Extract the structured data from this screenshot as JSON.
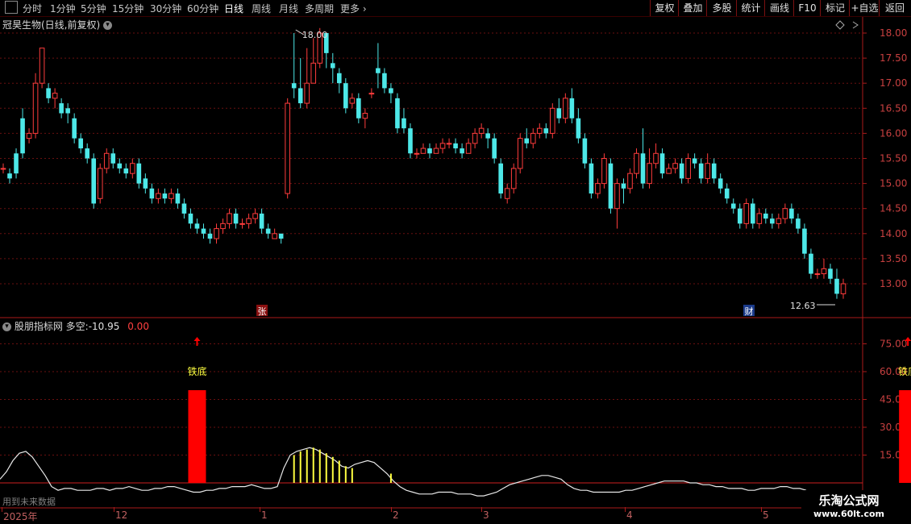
{
  "toolbar": {
    "periods": [
      "分时",
      "1分钟",
      "5分钟",
      "15分钟",
      "30分钟",
      "60分钟",
      "日线",
      "周线",
      "月线",
      "多周期",
      "更多"
    ],
    "active_period": "日线",
    "right_buttons": [
      "复权",
      "叠加",
      "多股",
      "统计",
      "画线",
      "F10",
      "标记",
      "+自选",
      "返回"
    ]
  },
  "stock": {
    "title": "冠昊生物(日线,前复权)",
    "high_label": "18.00",
    "low_label": "12.63",
    "badge_zhang": "张",
    "badge_cai": "财"
  },
  "indicator": {
    "name": "股朋指标网",
    "label": "多空:",
    "value": "-10.95",
    "value2": "0.00",
    "signal_text": "铁底",
    "future_note": "用到未来数据"
  },
  "price_axis": [
    "18.00",
    "17.50",
    "17.00",
    "16.50",
    "16.00",
    "15.50",
    "15.00",
    "14.50",
    "14.00",
    "13.50",
    "13.00"
  ],
  "indicator_axis": [
    "75.00",
    "60.00",
    "45.00",
    "30.00",
    "15.00"
  ],
  "date_axis": [
    "2025年",
    "12",
    "1",
    "2",
    "3",
    "4",
    "5"
  ],
  "watermark": {
    "line1": "乐淘公式网",
    "line2": "www.60lt.com"
  },
  "colors": {
    "up": "#ff3c3c",
    "down": "#4de8e8",
    "grid": "#6a1010",
    "signal": "#ff0000",
    "text_yellow": "#ffff40"
  },
  "candles": [
    [
      15.3,
      15.3,
      15.4,
      15.2
    ],
    [
      15.2,
      15.1,
      15.3,
      15.0
    ],
    [
      15.6,
      15.2,
      15.7,
      15.1
    ],
    [
      16.3,
      15.6,
      16.5,
      15.5
    ],
    [
      15.9,
      16.0,
      16.1,
      15.8
    ],
    [
      16.0,
      17.0,
      17.2,
      15.9
    ],
    [
      17.0,
      17.7,
      17.7,
      16.9
    ],
    [
      16.9,
      16.7,
      17.0,
      16.6
    ],
    [
      16.7,
      16.8,
      16.9,
      16.5
    ],
    [
      16.6,
      16.4,
      16.7,
      16.3
    ],
    [
      16.5,
      16.4,
      16.6,
      16.2
    ],
    [
      16.3,
      15.9,
      16.4,
      15.8
    ],
    [
      15.9,
      15.7,
      16.0,
      15.6
    ],
    [
      15.7,
      15.5,
      15.8,
      15.4
    ],
    [
      15.5,
      14.6,
      15.6,
      14.5
    ],
    [
      14.7,
      15.3,
      15.4,
      14.6
    ],
    [
      15.3,
      15.6,
      15.7,
      15.2
    ],
    [
      15.6,
      15.4,
      15.7,
      15.3
    ],
    [
      15.4,
      15.3,
      15.5,
      15.2
    ],
    [
      15.3,
      15.2,
      15.4,
      15.1
    ],
    [
      15.2,
      15.4,
      15.5,
      15.1
    ],
    [
      15.4,
      15.0,
      15.5,
      14.9
    ],
    [
      15.1,
      14.9,
      15.2,
      14.8
    ],
    [
      14.9,
      14.7,
      15.0,
      14.6
    ],
    [
      14.7,
      14.8,
      14.9,
      14.6
    ],
    [
      14.8,
      14.7,
      14.9,
      14.6
    ],
    [
      14.7,
      14.8,
      14.9,
      14.6
    ],
    [
      14.8,
      14.6,
      14.9,
      14.5
    ],
    [
      14.6,
      14.4,
      14.7,
      14.3
    ],
    [
      14.4,
      14.2,
      14.5,
      14.1
    ],
    [
      14.2,
      14.1,
      14.3,
      14.0
    ],
    [
      14.1,
      14.0,
      14.2,
      13.9
    ],
    [
      14.0,
      13.9,
      14.1,
      13.8
    ],
    [
      13.9,
      14.1,
      14.2,
      13.8
    ],
    [
      14.1,
      14.2,
      14.3,
      14.0
    ],
    [
      14.2,
      14.4,
      14.5,
      14.1
    ],
    [
      14.4,
      14.2,
      14.5,
      14.1
    ],
    [
      14.2,
      14.2,
      14.3,
      14.1
    ],
    [
      14.2,
      14.3,
      14.4,
      14.1
    ],
    [
      14.3,
      14.4,
      14.5,
      14.2
    ],
    [
      14.4,
      14.1,
      14.5,
      14.0
    ],
    [
      14.1,
      14.0,
      14.2,
      13.9
    ],
    [
      13.9,
      14.0,
      14.1,
      13.9
    ],
    [
      14.0,
      13.9,
      14.0,
      13.8
    ],
    [
      14.8,
      16.6,
      16.7,
      14.7
    ],
    [
      17.0,
      16.9,
      18.0,
      16.7
    ],
    [
      16.9,
      16.6,
      17.5,
      16.5
    ],
    [
      16.6,
      17.0,
      17.7,
      16.5
    ],
    [
      17.0,
      17.4,
      17.9,
      17.0
    ],
    [
      17.4,
      18.0,
      18.1,
      17.3
    ],
    [
      18.0,
      17.6,
      18.0,
      17.3
    ],
    [
      17.4,
      17.3,
      17.6,
      17.0
    ],
    [
      17.2,
      17.0,
      17.3,
      16.8
    ],
    [
      17.0,
      16.5,
      17.1,
      16.4
    ],
    [
      16.6,
      16.7,
      16.8,
      16.5
    ],
    [
      16.7,
      16.3,
      16.8,
      16.2
    ],
    [
      16.3,
      16.4,
      16.5,
      16.1
    ],
    [
      16.8,
      16.8,
      16.9,
      16.7
    ],
    [
      17.3,
      17.2,
      17.8,
      16.9
    ],
    [
      17.2,
      16.9,
      17.3,
      16.8
    ],
    [
      16.9,
      16.8,
      17.0,
      16.6
    ],
    [
      16.7,
      16.1,
      16.8,
      16.0
    ],
    [
      16.3,
      16.1,
      16.5,
      16.0
    ],
    [
      16.1,
      15.6,
      16.2,
      15.5
    ],
    [
      15.6,
      15.6,
      15.7,
      15.5
    ],
    [
      15.6,
      15.7,
      15.8,
      15.6
    ],
    [
      15.7,
      15.6,
      15.8,
      15.5
    ],
    [
      15.6,
      15.7,
      15.8,
      15.6
    ],
    [
      15.7,
      15.8,
      15.9,
      15.6
    ],
    [
      15.8,
      15.8,
      15.9,
      15.7
    ],
    [
      15.8,
      15.7,
      15.9,
      15.6
    ],
    [
      15.7,
      15.6,
      15.8,
      15.5
    ],
    [
      15.6,
      15.8,
      15.9,
      15.6
    ],
    [
      15.8,
      16.0,
      16.1,
      15.7
    ],
    [
      16.0,
      16.1,
      16.2,
      15.9
    ],
    [
      16.0,
      15.9,
      16.1,
      15.7
    ],
    [
      15.9,
      15.5,
      16.0,
      15.4
    ],
    [
      15.4,
      14.8,
      15.5,
      14.7
    ],
    [
      14.7,
      14.9,
      15.0,
      14.6
    ],
    [
      14.9,
      15.3,
      15.4,
      14.8
    ],
    [
      15.3,
      15.9,
      16.0,
      15.2
    ],
    [
      15.9,
      15.8,
      16.1,
      15.7
    ],
    [
      15.8,
      16.0,
      16.1,
      15.7
    ],
    [
      16.0,
      16.1,
      16.2,
      15.9
    ],
    [
      16.1,
      16.0,
      16.2,
      15.9
    ],
    [
      16.0,
      16.5,
      16.6,
      15.9
    ],
    [
      16.5,
      16.3,
      16.7,
      16.2
    ],
    [
      16.3,
      16.7,
      16.8,
      16.2
    ],
    [
      16.7,
      16.3,
      16.9,
      16.2
    ],
    [
      16.3,
      15.9,
      16.5,
      15.8
    ],
    [
      15.9,
      15.4,
      16.0,
      15.3
    ],
    [
      15.4,
      14.8,
      15.5,
      14.7
    ],
    [
      14.8,
      15.0,
      15.1,
      14.7
    ],
    [
      15.0,
      15.5,
      15.6,
      14.9
    ],
    [
      15.4,
      14.5,
      15.5,
      14.4
    ],
    [
      14.5,
      15.0,
      15.1,
      14.1
    ],
    [
      15.0,
      14.9,
      15.1,
      14.6
    ],
    [
      14.9,
      15.2,
      15.3,
      14.8
    ],
    [
      15.2,
      15.6,
      15.7,
      15.1
    ],
    [
      15.6,
      15.0,
      16.1,
      14.9
    ],
    [
      15.0,
      15.4,
      15.7,
      14.9
    ],
    [
      15.4,
      15.6,
      15.8,
      15.3
    ],
    [
      15.6,
      15.2,
      15.7,
      15.1
    ],
    [
      15.2,
      15.3,
      15.4,
      15.2
    ],
    [
      15.3,
      15.4,
      15.5,
      15.2
    ],
    [
      15.4,
      15.1,
      15.5,
      15.0
    ],
    [
      15.1,
      15.5,
      15.6,
      15.0
    ],
    [
      15.5,
      15.4,
      15.6,
      15.3
    ],
    [
      15.4,
      15.1,
      15.5,
      15.0
    ],
    [
      15.1,
      15.4,
      15.6,
      15.0
    ],
    [
      15.4,
      15.1,
      15.5,
      15.0
    ],
    [
      15.1,
      14.9,
      15.2,
      14.8
    ],
    [
      14.9,
      14.7,
      15.0,
      14.6
    ],
    [
      14.6,
      14.5,
      14.7,
      14.4
    ],
    [
      14.5,
      14.2,
      14.6,
      14.1
    ],
    [
      14.2,
      14.6,
      14.7,
      14.1
    ],
    [
      14.6,
      14.2,
      14.7,
      14.1
    ],
    [
      14.2,
      14.4,
      14.5,
      14.1
    ],
    [
      14.4,
      14.3,
      14.5,
      14.2
    ],
    [
      14.3,
      14.2,
      14.4,
      14.1
    ],
    [
      14.2,
      14.3,
      14.4,
      14.1
    ],
    [
      14.3,
      14.5,
      14.6,
      14.2
    ],
    [
      14.5,
      14.3,
      14.6,
      14.2
    ],
    [
      14.3,
      14.1,
      14.4,
      14.0
    ],
    [
      14.1,
      13.6,
      14.2,
      13.5
    ],
    [
      13.6,
      13.2,
      13.7,
      13.1
    ],
    [
      13.2,
      13.2,
      13.3,
      13.1
    ],
    [
      13.2,
      13.3,
      13.5,
      13.1
    ],
    [
      13.3,
      13.1,
      13.4,
      13.0
    ],
    [
      13.1,
      12.8,
      13.3,
      12.7
    ],
    [
      12.8,
      13.0,
      13.1,
      12.7
    ]
  ],
  "indicator_line": [
    2,
    6,
    12,
    16,
    17,
    14,
    9,
    4,
    -2,
    -4,
    -3,
    -3,
    -4,
    -4,
    -4,
    -3,
    -3,
    -4,
    -3,
    -3,
    -2,
    -3,
    -4,
    -4,
    -3,
    -3,
    -2,
    -2,
    -3,
    -4,
    -5,
    -5,
    -4,
    -4,
    -3,
    -3,
    -2,
    -2,
    -2,
    -1,
    -2,
    -3,
    -3,
    -2,
    8,
    15,
    17,
    18,
    19,
    18,
    16,
    14,
    12,
    9,
    8,
    10,
    11,
    12,
    11,
    8,
    5,
    1,
    -2,
    -4,
    -5,
    -6,
    -6,
    -6,
    -5,
    -5,
    -5,
    -6,
    -6,
    -6,
    -7,
    -7,
    -6,
    -5,
    -3,
    -1,
    0,
    1,
    2,
    3,
    4,
    4,
    3,
    2,
    -1,
    -3,
    -4,
    -4,
    -5,
    -5,
    -5,
    -5,
    -5,
    -4,
    -4,
    -3,
    -2,
    -1,
    0,
    1,
    1,
    1,
    1,
    0,
    0,
    -1,
    -1,
    -2,
    -2,
    -3,
    -3,
    -3,
    -4,
    -4,
    -3,
    -3,
    -3,
    -2,
    -2,
    -3,
    -3,
    -4
  ],
  "yellow_bars": [
    45,
    46,
    47,
    48,
    49,
    50,
    51,
    52,
    53,
    54,
    60
  ],
  "signals": [
    {
      "index": 30,
      "value": 50
    },
    {
      "index": 140,
      "value": 50
    }
  ]
}
